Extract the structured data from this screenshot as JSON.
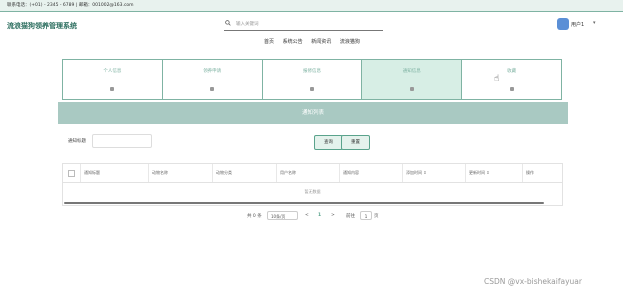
{
  "topbar": {
    "contact": "联系电话：(+01) - 2345 - 6789 | 邮箱：001002@163.com"
  },
  "header": {
    "title": "流浪猫狗领养管理系统",
    "search_placeholder": "输入关键词",
    "nav": [
      "首页",
      "系统公告",
      "新闻资讯",
      "流浪猫狗"
    ],
    "user_label": "用户1",
    "caret": "▾"
  },
  "tiles": [
    {
      "label": "个人信息",
      "active": false
    },
    {
      "label": "领养申请",
      "active": false
    },
    {
      "label": "报修信息",
      "active": false
    },
    {
      "label": "通知信息",
      "active": true
    },
    {
      "label": "收藏",
      "active": false
    }
  ],
  "banner": {
    "title": "通知列表"
  },
  "filter": {
    "label": "通知标题",
    "value": "",
    "search_button": "查询",
    "reset_button": "重置"
  },
  "table": {
    "columns": [
      "通知标题",
      "动物名称",
      "动物分类",
      "用户名称",
      "通知内容",
      "添加时间 ⇕",
      "更新时间 ⇕",
      "操作"
    ],
    "empty_text": "暂无数据"
  },
  "pager": {
    "total": "共 0 条",
    "page_size": "10条/页",
    "prev": "<",
    "current": "1",
    "next": ">",
    "goto_label": "前往",
    "goto_value": "1",
    "page_suffix": "页"
  },
  "watermark": "CSDN @vx-bishekaifayuar",
  "colors": {
    "accent": "#7fb3a3",
    "banner": "#a9c9c2",
    "active_tile": "#d7eee5"
  },
  "icons": [
    "search-icon",
    "user-avatar-icon",
    "tile-icon",
    "mouse-cursor-icon"
  ]
}
